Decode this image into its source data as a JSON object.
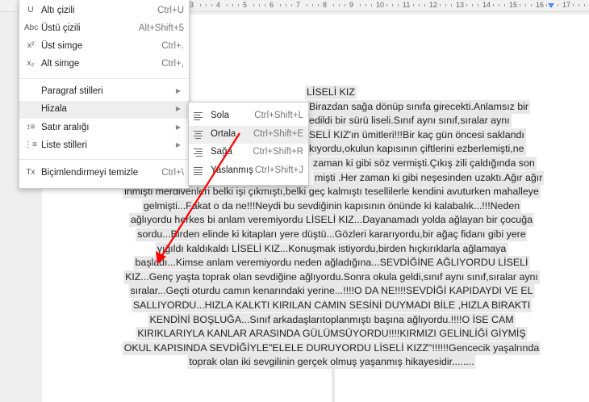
{
  "ruler": {
    "numbers": [
      "3",
      "4",
      "5",
      "6",
      "7",
      "8",
      "9",
      "10",
      "11",
      "12",
      "13",
      "14",
      "15",
      "16",
      "17"
    ]
  },
  "format_menu": {
    "items": [
      {
        "icon": "underline-icon",
        "glyph": "U",
        "label": "Altı çizili",
        "shortcut": "Ctrl+U"
      },
      {
        "icon": "strikethrough-icon",
        "glyph": "Abc",
        "label": "Üstü çizili",
        "shortcut": "Alt+Shift+5"
      },
      {
        "icon": "superscript-icon",
        "glyph": "x²",
        "label": "Üst simge",
        "shortcut": "Ctrl+."
      },
      {
        "icon": "subscript-icon",
        "glyph": "x₂",
        "label": "Alt simge",
        "shortcut": "Ctrl+,"
      },
      {
        "icon": "",
        "glyph": "",
        "label": "Paragraf stilleri",
        "shortcut": ""
      },
      {
        "icon": "",
        "glyph": "",
        "label": "Hizala",
        "shortcut": ""
      },
      {
        "icon": "line-spacing-icon",
        "glyph": "↕≡",
        "label": "Satır aralığı",
        "shortcut": ""
      },
      {
        "icon": "list-icon",
        "glyph": "⋮≡",
        "label": "Liste stilleri",
        "shortcut": ""
      },
      {
        "icon": "clear-formatting-icon",
        "glyph": "Tx",
        "label": "Biçimlendirmeyi temizle",
        "shortcut": "Ctrl+\\"
      }
    ]
  },
  "align_submenu": {
    "items": [
      {
        "label": "Sola",
        "shortcut": "Ctrl+Shift+L"
      },
      {
        "label": "Ortala",
        "shortcut": "Ctrl+Shift+E"
      },
      {
        "label": "Sağa",
        "shortcut": "Ctrl+Shift+R"
      },
      {
        "label": "Yaslanmış",
        "shortcut": "Ctrl+Shift+J"
      }
    ]
  },
  "document": {
    "lines": [
      "LİSELİ KIZ",
      "Birazdan sağa dönüp sınıfa girecekti.Anlamsız bir",
      "edildi bir sürü liseli.Sınıf aynı sınıf,sıralar aynı",
      "SELİ KIZ'ın ümitleri!!!Bir kaç gün öncesi saklandı",
      "kıyordu,okulun kapısının çiftlerini ezberlemişti,ne",
      "zaman ki gibi söz vermişti.Çıkış zili çaldığında son",
      "mişti .Her zaman ki gibi neşesinden uzaktı.Ağır ağır",
      "inmişti merdivenleri belki işi çıkmıştı,belki geç kalmıştı tesellilerle kendini avuturken mahalleye",
      "gelmişti...Fakat o da ne!!!Neydi bu sevdiğinin kapısının önünde ki kalabalık...!!!Neden",
      "ağlıyordu herkes bi anlam veremiyordu LİSELİ KIZ...Dayanamadı yolda ağlayan bir çocuğa",
      "sordu...Birden elinde ki kitapları yere düştü...Gözleri kararıyordu,bir ağaç fidanı gibi yere",
      "yığıldı kaldıkaldı LİSELİ KIZ...Konuşmak istiyordu,birden hıçkırıklarla ağlamaya",
      "başladı...Kimse anlam veremiyordu neden ağladığına...SEVDİĞİNE AĞLIYORDU LİSELİ",
      "KIZ...Genç yaşta toprak olan sevdiğine ağlıyordu.Sonra okula geldi,sınıf aynı sınıf,sıralar aynı",
      "sıralar...Geçti oturdu camın kenarındaki yerine...!!!!O DA NE!!!!SEVDİĞİ KAPIDAYDI VE EL",
      "SALLIYORDU...HIZLA KALKTI KIRILAN CAMIN SESİNİ DUYMADI BİLE ,HIZLA BIRAKTI",
      "KENDİNİ BOŞLUĞA...Sınıf arkadaşlarıtoplanmıştı başına ağlıyordu.!!!!O İSE CAM",
      "KIRIKLARIYLA KANLAR ARASINDA GÜLÜMSÜYORDU!!!!KIRMIZI GELİNLİĞİ GİYMİŞ",
      "OKUL KAPISINDA SEVDİĞİYLE\"ELELE DURUYORDU LİSELİ KIZZ\"!!!!!!Gencecik yaşalrında",
      "toprak olan iki sevgilinin gerçek olmuş yaşanmış hikayesidir........"
    ]
  },
  "colors": {
    "annotation_arrow": "#ff0000",
    "selection": "#e8e8e8",
    "ruler_marker": "#4a8af4"
  }
}
